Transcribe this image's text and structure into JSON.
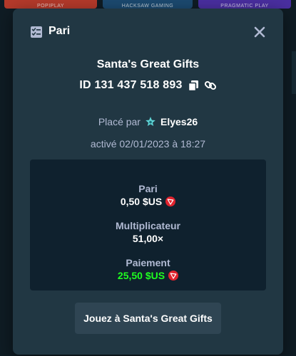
{
  "background": {
    "thumbnails": [
      "POPIPLAY",
      "HACKSAW GAMING",
      "PRAGMATIC PLAY"
    ]
  },
  "modal": {
    "title": "Pari",
    "game_title": "Santa's Great Gifts",
    "bet_id": "ID 131 437 518 893",
    "placed_by_label": "Placé par",
    "user_name": "Elyes26",
    "activated": "activé 02/01/2023 à 18:27",
    "details": {
      "bet_label": "Pari",
      "bet_value": "0,50 $US",
      "multiplier_label": "Multiplicateur",
      "multiplier_value": "51,00×",
      "payout_label": "Paiement",
      "payout_value": "25,50 $US"
    },
    "play_button": "Jouez à Santa's Great Gifts"
  },
  "colors": {
    "modal_bg": "#213743",
    "details_bg": "#0f212e",
    "accent_green": "#1fff20",
    "muted_text": "#b1bad3",
    "coin_red": "#e0232e"
  },
  "icons": {
    "header": "bet-slip-icon",
    "close": "close-icon",
    "copy": "copy-icon",
    "link": "link-icon",
    "user_badge": "vip-star-icon",
    "currency": "tron-coin-icon"
  }
}
